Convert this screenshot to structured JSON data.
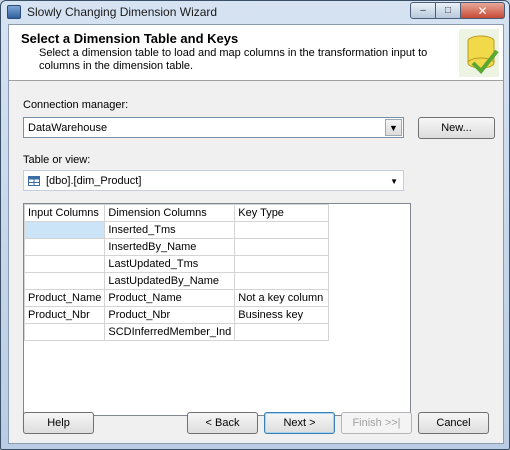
{
  "window": {
    "title": "Slowly Changing Dimension Wizard",
    "minimize_glyph": "–",
    "maximize_glyph": "□",
    "close_glyph": "✕"
  },
  "header": {
    "title": "Select a Dimension Table and Keys",
    "subtitle": "Select a dimension table to load and map columns in the transformation input to columns in the dimension table."
  },
  "connection": {
    "label": "Connection manager:",
    "value": "DataWarehouse",
    "new_button": "New..."
  },
  "table_view": {
    "label": "Table or view:",
    "value": "[dbo].[dim_Product]"
  },
  "mapping_table": {
    "headers": [
      "Input Columns",
      "Dimension Columns",
      "Key Type"
    ],
    "rows": [
      [
        "",
        "Inserted_Tms",
        ""
      ],
      [
        "",
        "InsertedBy_Name",
        ""
      ],
      [
        "",
        "LastUpdated_Tms",
        ""
      ],
      [
        "",
        "LastUpdatedBy_Name",
        ""
      ],
      [
        "Product_Name",
        "Product_Name",
        "Not a key column"
      ],
      [
        "Product_Nbr",
        "Product_Nbr",
        "Business key"
      ],
      [
        "",
        "SCDInferredMember_Ind",
        ""
      ]
    ]
  },
  "buttons": {
    "help": "Help",
    "back": "< Back",
    "next": "Next >",
    "finish": "Finish >>|",
    "cancel": "Cancel"
  },
  "colors": {
    "title_bar": "#c9d6e6",
    "selected_cell": "#cce4f7",
    "close_button": "#c74a33"
  }
}
